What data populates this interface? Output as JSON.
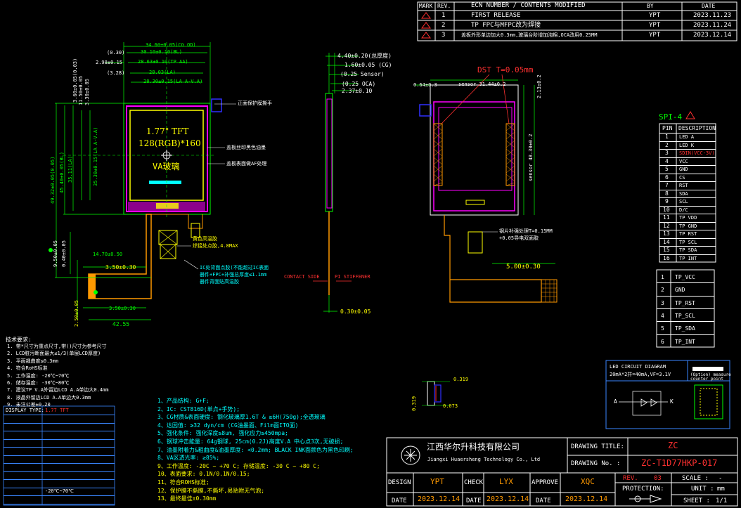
{
  "revision_table": {
    "headers": [
      "MARK",
      "REV.",
      "ECN NUMBER / CONTENTS MODIFIED",
      "BY",
      "DATE"
    ],
    "rows": [
      {
        "rev": "1",
        "content": "FIRST RELEASE",
        "by": "YPT",
        "date": "2023.11.23"
      },
      {
        "rev": "2",
        "content": "TP FPC与MFPC改为焊接",
        "by": "YPT",
        "date": "2023.11.24"
      },
      {
        "rev": "3",
        "content": "盖板外形单边加大0.3mm,玻璃台阶增加泡棉,OCA改用0.25MM",
        "by": "YPT",
        "date": "2023.12.14"
      }
    ]
  },
  "front_view": {
    "dims": {
      "d1": "34.60±0.05(CG OD)",
      "d2": "(0.30)",
      "d3": "30.10±0.10(BL)",
      "d4": "2.98±0.15",
      "d5": "28.63±0.10(TP AA)",
      "d6": "(3.28)",
      "d7": "28.03(LA)",
      "d8": "28.30±0.15(LA A-V.A)",
      "left1": "3.60±0.05(0.03)",
      "left2": "49.32±0.05(0.05)",
      "left3": "45.40±0.05(BL)",
      "left4": "35.11(LA)",
      "left5": "35.30±0.15(LA A-V.A)",
      "left6": "11.50±0.05",
      "left7": "3.30±0.05",
      "fpc1": "14.70±0.50",
      "fpc2": "3.50±0.30",
      "fpc3": "3.50±0.30",
      "fpc4": "42.55",
      "fpc5": "9.50±0.05",
      "fpc6": "0.40±0.05",
      "fpc7": "2.50±0.05"
    },
    "lcd_title": "1.77\" TFT",
    "lcd_res": "128(RGB)*160",
    "lcd_glass": "VA玻璃",
    "note_protect": "正面保护膜撕手",
    "note_ink": "盖板丝印黑色油墨",
    "note_ar": "盖板表面做AF处理",
    "note_foam": "黄色高温胶",
    "note_foam2": "焊接处点胶,4.8MAX",
    "note_ic": "IC处背面点胶(不能超过IC表面",
    "note_ic2": "器件+FPC+补强总厚度≤1.1mm",
    "note_ic3": "器件背面贴高温胶"
  },
  "side_view": {
    "d1": "4.40±0.20(总厚度)",
    "d2": "1.60±0.05 (CG)",
    "d3": "(0.25 Sensor)",
    "d4": "(0.25 OCA)",
    "d5": "2.37±0.10",
    "contact": "CONTACT SIDE",
    "stiff": "PI STIFFENER",
    "bottom": "0.30±0.05"
  },
  "back_view": {
    "dst": "DST T=0.05mm",
    "top": "0.64±0.3",
    "sensor_w": "sensor 31.44±0.2",
    "sensor_h": "sensor 48.30±0.2",
    "right": "2.13±0.2",
    "fpc": "5.00±0.30",
    "note1": "钢片补强处理T=0.15MM",
    "note2": "+0.05导电双面胶"
  },
  "spi_table": {
    "title": "SPI-4",
    "headers": [
      "PIN",
      "DESCRIPTION"
    ],
    "rows": [
      [
        "1",
        "LED A"
      ],
      [
        "2",
        "LED K"
      ],
      [
        "3",
        "SDIN(VCC-3V)"
      ],
      [
        "4",
        "VCC"
      ],
      [
        "5",
        "GND"
      ],
      [
        "6",
        "CS"
      ],
      [
        "7",
        "RST"
      ],
      [
        "8",
        "SDA"
      ],
      [
        "9",
        "SCL"
      ],
      [
        "10",
        "D/C"
      ],
      [
        "11",
        "TP VDD"
      ],
      [
        "12",
        "TP GND"
      ],
      [
        "13",
        "TP RST"
      ],
      [
        "14",
        "TP SCL"
      ],
      [
        "15",
        "TP SDA"
      ],
      [
        "16",
        "TP INT"
      ]
    ]
  },
  "tp_table": {
    "rows": [
      [
        "1",
        "TP_VCC"
      ],
      [
        "2",
        "GND"
      ],
      [
        "3",
        "TP_RST"
      ],
      [
        "4",
        "TP_SCL"
      ],
      [
        "5",
        "TP_SDA"
      ],
      [
        "6",
        "TP_INT"
      ]
    ]
  },
  "tech_req": {
    "title": "技术要求:",
    "items": [
      "1. 带*尺寸为重点尺寸,带()尺寸为参考尺寸",
      "2. LCD脏污断面最大≤1/3(单层LCD厚度)",
      "3. 平面翘曲度≤0.3mm",
      "4. 符合RoHS标准",
      "5. 工作温度: -20℃~70℃",
      "6. 储存温度: -30℃~80℃",
      "7. 建议TP V.A外留边LCD A.A单边大0.4mm",
      "8. 液晶外留边LCD A.A单边大0.3mm",
      "9. 未注公差±0.20"
    ]
  },
  "spec_table": {
    "rows": [
      [
        "DISPLAY TYPE:",
        "1.77 TFT"
      ],
      [
        "",
        ""
      ],
      [
        "",
        ""
      ],
      [
        "",
        ""
      ],
      [
        "",
        ""
      ],
      [
        "",
        ""
      ],
      [
        "",
        ""
      ],
      [
        "",
        ""
      ],
      [
        "",
        ""
      ],
      [
        "",
        ""
      ],
      [
        "",
        "-20℃~70℃"
      ],
      [
        "",
        ""
      ]
    ]
  },
  "product_notes": [
    "1、产品结构: G+F;",
    "2、IC: CST816D(单点+手势);",
    "3、CG材质&表面硬度: 钢化玻璃厚1.6T & ≥6H(750g);全透玻璃",
    "4、达因值: ≥32 dyn/cm (CG油墨面、Film面ITO面)",
    "5、强化条件: 强化深度≥8um, 强化应力≥450mpa;",
    "6、钢球冲击能量: 64g钢球, 25cm(0.2J)高度V.A 中心点3次,无破损;",
    "7、油墨附着力&粗曲度&油墨厚度: <0.2mm; BLACK INK面颜色为黑色印刷;",
    "8、VA区透光率: ≥85%;",
    "9、工作温度: -20C ~ +70 C; 存储温度: -30 C ~ +80 C;",
    "10、表面要求: 0.1N/0.1N/0.15;",
    "11、符合ROHS标准;",
    "12、保护膜不撕膜,不撕坏,易贴附无气泡;",
    "13、最终最佳±0.30mm"
  ],
  "led_diagram": {
    "title": "LED CIRCUIT DIAGRAM",
    "sub": "20mA*2并=40mA,VF=3.1V",
    "a": "A",
    "k": "K",
    "box_note": "(Option) measure",
    "box_note2": "counter point"
  },
  "small_dims": {
    "a": "0.319",
    "b": "0.073",
    "c": "0.319"
  },
  "title_block": {
    "company_cn": "江西华尔升科技有限公司",
    "company_en": "Jiangxi Huaersheng Technology Co., Ltd",
    "drawing_title_label": "DRAWING TITLE:",
    "drawing_title": "ZC",
    "drawing_no_label": "DRAWING No. :",
    "drawing_no": "ZC-T1D77HKP-017",
    "design_label": "DESIGN",
    "design": "YPT",
    "check_label": "CHECK",
    "check": "LYX",
    "approve_label": "APPROVE",
    "approve": "XQC",
    "date_label": "DATE",
    "date1": "2023.12.14",
    "date2": "2023.12.14",
    "date3": "2023.12.14",
    "rev_label": "REV.",
    "rev": "03",
    "scale_label": "SCALE :",
    "scale": "-",
    "protection_label": "PROTECTION:",
    "unit_label": "UNIT :",
    "unit": "mm",
    "sheet_label": "SHEET :",
    "sheet": "1/1"
  },
  "colors": {
    "magenta": "#ff00ff",
    "yellow": "#ffff00",
    "orange": "#ff9900",
    "green": "#00ff00",
    "red": "#ff3030",
    "cyan": "#00ffff",
    "blue": "#3030ff"
  }
}
